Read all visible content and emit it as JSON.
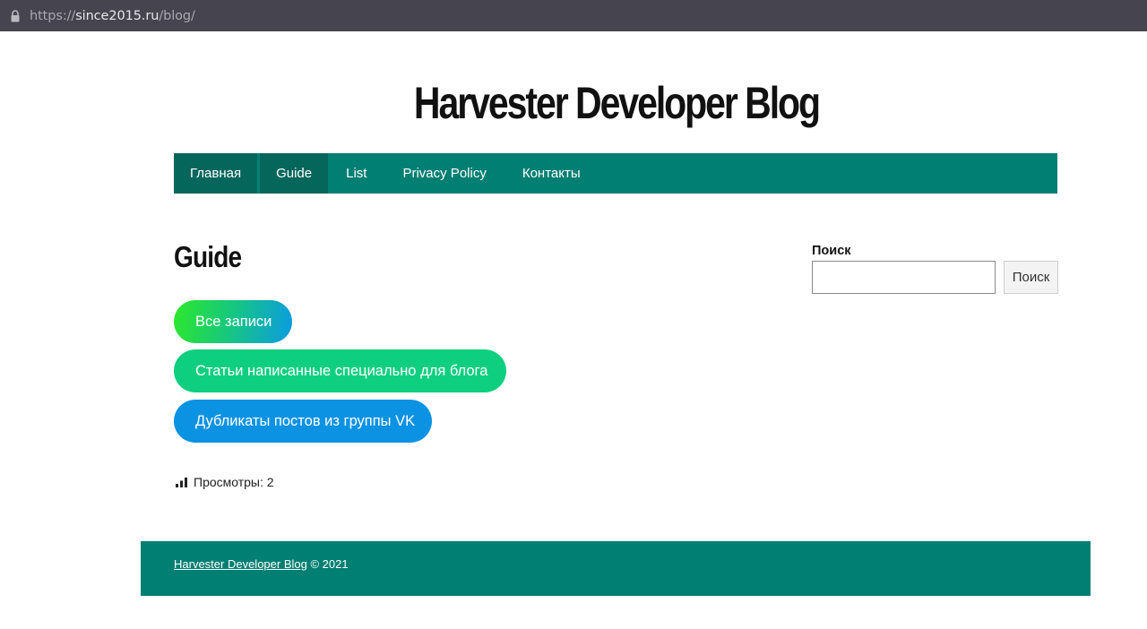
{
  "browser": {
    "url_prefix": "https://",
    "url_host": "since2015.ru",
    "url_path": "/blog/"
  },
  "site": {
    "title": "Harvester Developer Blog"
  },
  "nav": {
    "items": [
      {
        "label": "Главная"
      },
      {
        "label": "Guide"
      },
      {
        "label": "List"
      },
      {
        "label": "Privacy Policy"
      },
      {
        "label": "Контакты"
      }
    ]
  },
  "main": {
    "title": "Guide",
    "categories": [
      {
        "label": "Все записи"
      },
      {
        "label": "Статьи написанные специально для блога"
      },
      {
        "label": "Дубликаты постов из группы VK"
      }
    ],
    "views_label": "Просмотры: 2"
  },
  "sidebar": {
    "search_label": "Поиск",
    "search_value": "",
    "search_button": "Поиск"
  },
  "footer": {
    "link": "Harvester Developer Blog",
    "copyright": "© 2021"
  },
  "colors": {
    "nav_bg": "#007f72",
    "nav_active_bg": "#05665c",
    "pill_green": "#0ecf80",
    "pill_blue": "#0c92e3",
    "address_bar": "#45444f"
  }
}
